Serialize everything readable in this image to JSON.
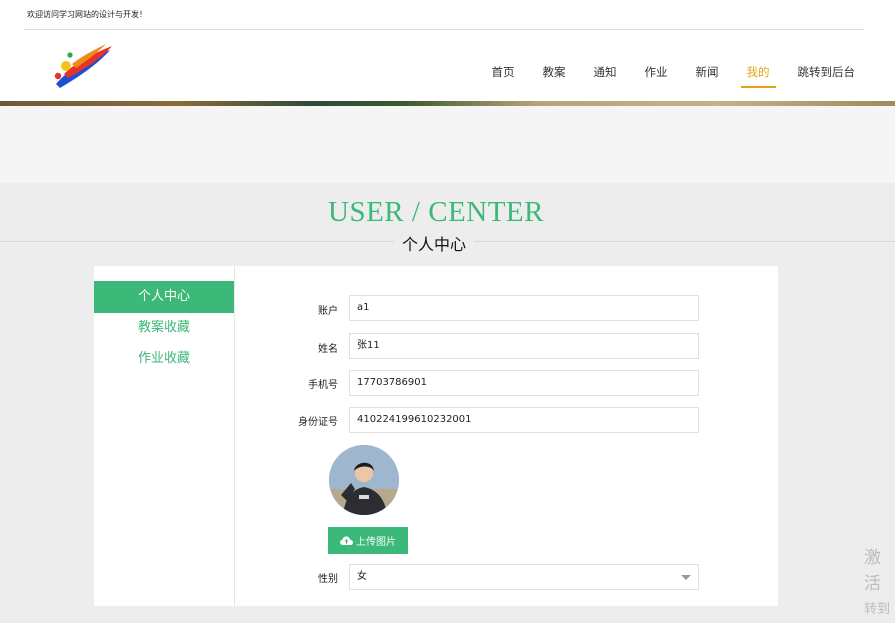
{
  "header": {
    "welcome": "欢迎访问学习网站的设计与开发！",
    "nav": [
      "首页",
      "教案",
      "通知",
      "作业",
      "新闻",
      "我的",
      "跳转到后台"
    ],
    "active_nav": "我的",
    "logo_icon": "brand-logo-icon"
  },
  "section": {
    "title_en": "USER / CENTER",
    "title_cn": "个人中心"
  },
  "sidebar": {
    "items": [
      "个人中心",
      "教案收藏",
      "作业收藏"
    ],
    "active": "个人中心"
  },
  "form": {
    "account_label": "账户",
    "account_value": "a1",
    "name_label": "姓名",
    "name_value": "张11",
    "phone_label": "手机号",
    "phone_value": "17703786901",
    "id_label": "身份证号",
    "id_value": "410224199610232001",
    "upload_label": "上传图片",
    "gender_label": "性别",
    "gender_value": "女"
  },
  "watermark": {
    "line1": "激活",
    "line2": "转到"
  },
  "colors": {
    "accent": "#3cb878",
    "nav_active": "#e2a414"
  }
}
